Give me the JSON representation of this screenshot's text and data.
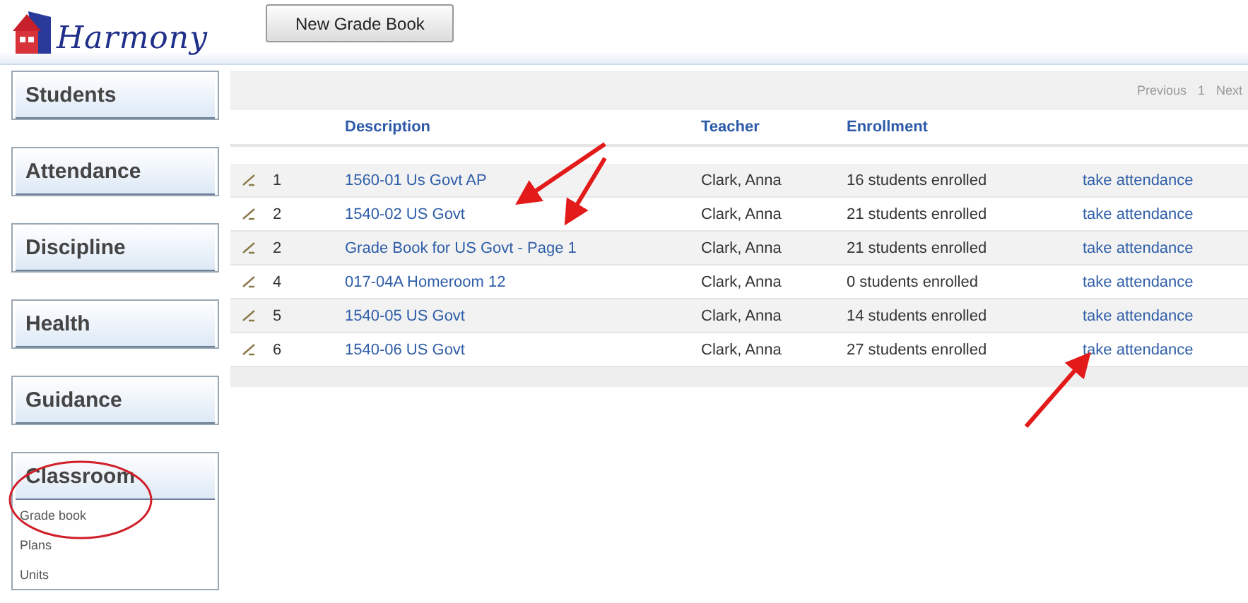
{
  "header": {
    "logo": "Harmony",
    "new_button": "New Grade Book"
  },
  "sidebar": [
    {
      "label": "Students"
    },
    {
      "label": "Attendance"
    },
    {
      "label": "Discipline"
    },
    {
      "label": "Health"
    },
    {
      "label": "Guidance"
    },
    {
      "label": "Classroom",
      "items": [
        "Grade book",
        "Plans",
        "Units"
      ]
    }
  ],
  "pagination": {
    "previous": "Previous",
    "page": "1",
    "next": "Next"
  },
  "table": {
    "columns": [
      "Description",
      "Teacher",
      "Enrollment"
    ],
    "rows": [
      {
        "number": "1",
        "description": "1560-01 Us Govt AP",
        "teacher": "Clark, Anna",
        "enrollment": "16 students enrolled",
        "action": "take attendance"
      },
      {
        "number": "2",
        "description": "1540-02 US Govt",
        "teacher": "Clark, Anna",
        "enrollment": "21 students enrolled",
        "action": "take attendance"
      },
      {
        "number": "2",
        "description": "Grade Book for US Govt - Page 1",
        "teacher": "Clark, Anna",
        "enrollment": "21 students enrolled",
        "action": "take attendance"
      },
      {
        "number": "4",
        "description": "017-04A Homeroom 12",
        "teacher": "Clark, Anna",
        "enrollment": "0 students enrolled",
        "action": "take attendance"
      },
      {
        "number": "5",
        "description": "1540-05 US Govt",
        "teacher": "Clark, Anna",
        "enrollment": "14 students enrolled",
        "action": "take attendance"
      },
      {
        "number": "6",
        "description": "1540-06 US Govt",
        "teacher": "Clark, Anna",
        "enrollment": "27 students enrolled",
        "action": "take attendance"
      }
    ]
  }
}
